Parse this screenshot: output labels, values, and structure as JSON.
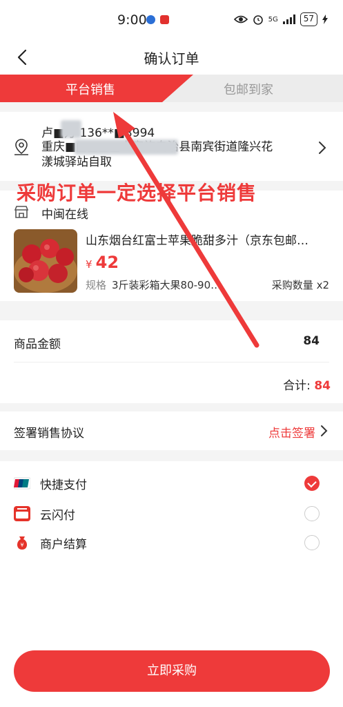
{
  "status_bar": {
    "time": "9:00",
    "network": "5G",
    "battery": "57"
  },
  "nav": {
    "title": "确认订单"
  },
  "tabs": [
    {
      "label": "平台销售",
      "active": true
    },
    {
      "label": "包邮到家",
      "active": false
    }
  ],
  "address": {
    "name_phone": "卢■万 136**■3994",
    "detail_line1": "重庆■■■■■土家族自治县南宾街道隆兴花",
    "detail_line2": "漾城驿站自取"
  },
  "annotation": "采购订单一定选择平台销售",
  "shop": {
    "name": "中闽在线"
  },
  "product": {
    "name": "山东烟台红富士苹果脆甜多汁（京东包邮…",
    "price_currency": "¥",
    "price": "42",
    "spec_label": "规格",
    "spec": "3斤装彩箱大果80-90…",
    "qty": "采购数量 x2"
  },
  "amount": {
    "label": "商品金额",
    "value": "84",
    "total_label": "合计:",
    "total_value": "84"
  },
  "agreement": {
    "label": "签署销售协议",
    "action": "点击签署"
  },
  "payment": [
    {
      "name": "快捷支付",
      "icon": "unionpay-icon",
      "selected": true
    },
    {
      "name": "云闪付",
      "icon": "cloud-quickpass-icon",
      "selected": false
    },
    {
      "name": "商户结算",
      "icon": "money-bag-icon",
      "selected": false
    }
  ],
  "submit": {
    "label": "立即采购"
  },
  "colors": {
    "accent": "#ee3a3a",
    "background": "#f4f4f4"
  }
}
